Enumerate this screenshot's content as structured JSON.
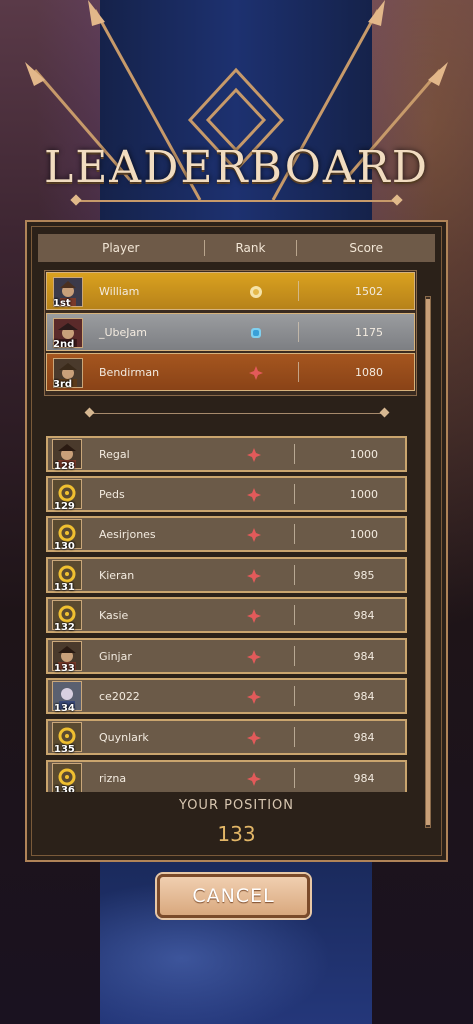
{
  "title": "LEADERBOARD",
  "header": {
    "player": "Player",
    "rank": "Rank",
    "score": "Score"
  },
  "top3": [
    {
      "position": "1st",
      "name": "William",
      "rank_icon": "sun-medal-icon",
      "score": "1502"
    },
    {
      "position": "2nd",
      "name": "_UbeJam",
      "rank_icon": "blue-gem-icon",
      "score": "1175"
    },
    {
      "position": "3rd",
      "name": "Bendirman",
      "rank_icon": "red-star-icon",
      "score": "1080"
    }
  ],
  "list": [
    {
      "position": "128",
      "name": "Regal",
      "rank_icon": "red-star-icon",
      "score": "1000"
    },
    {
      "position": "129",
      "name": "Peds",
      "rank_icon": "red-star-icon",
      "score": "1000"
    },
    {
      "position": "130",
      "name": "Aesirjones",
      "rank_icon": "red-star-icon",
      "score": "1000"
    },
    {
      "position": "131",
      "name": "Kieran",
      "rank_icon": "red-star-icon",
      "score": "985"
    },
    {
      "position": "132",
      "name": "Kasie",
      "rank_icon": "red-star-icon",
      "score": "984"
    },
    {
      "position": "133",
      "name": "Ginjar",
      "rank_icon": "red-star-icon",
      "score": "984"
    },
    {
      "position": "134",
      "name": "ce2022",
      "rank_icon": "red-star-icon",
      "score": "984"
    },
    {
      "position": "135",
      "name": "Quynlark",
      "rank_icon": "red-star-icon",
      "score": "984"
    },
    {
      "position": "136",
      "name": "rizna",
      "rank_icon": "red-star-icon",
      "score": "984"
    }
  ],
  "your_position": {
    "label": "YOUR POSITION",
    "value": "133"
  },
  "cancel_label": "CANCEL",
  "colors": {
    "gold": "#d9a11f",
    "silver": "#9a9c9f",
    "bronze": "#a5561f",
    "row": "#6b5a48",
    "accent": "#e2b667"
  }
}
